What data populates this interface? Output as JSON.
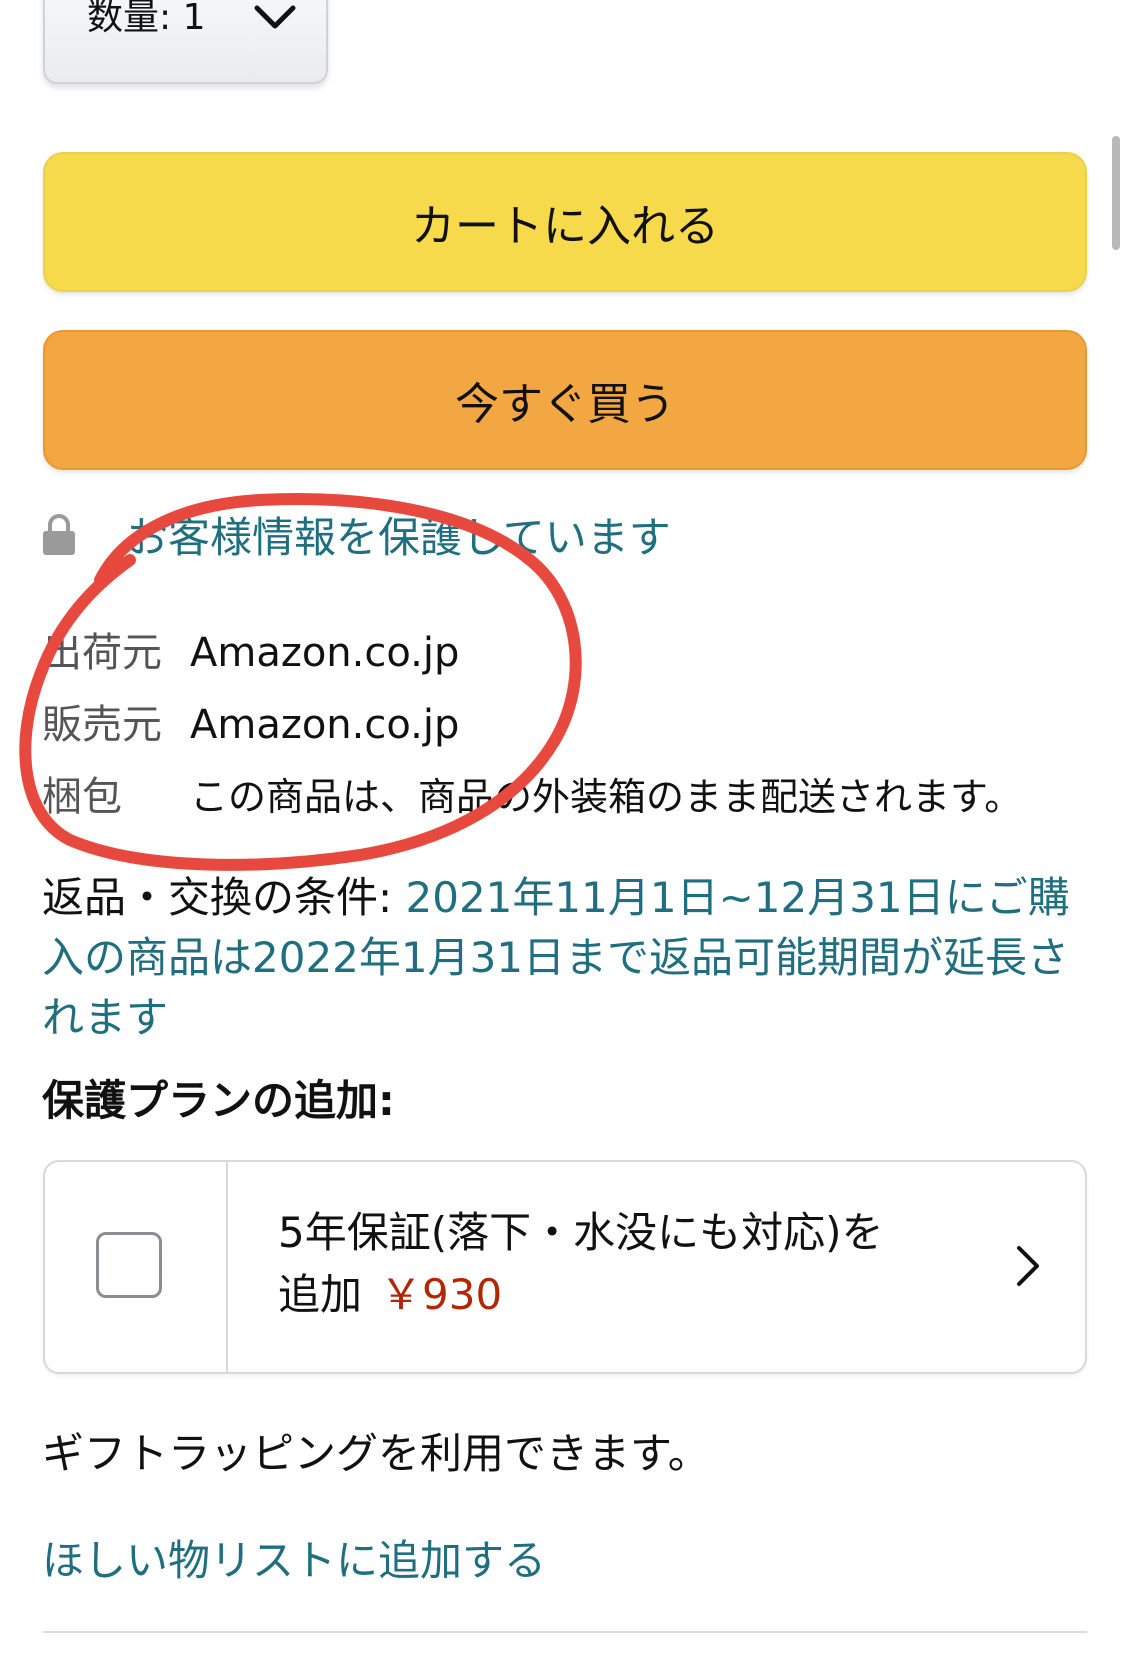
{
  "quantity": {
    "label": "数量: 1",
    "icon": "chevron-down-icon"
  },
  "buttons": {
    "add_to_cart": "カートに入れる",
    "buy_now": "今すぐ買う",
    "add_to_cart_color": "#f7d94c",
    "buy_now_color": "#f2a742"
  },
  "security": {
    "icon": "lock-icon",
    "text": "お客様情報を保護しています"
  },
  "seller_info": [
    {
      "label": "出荷元",
      "value": "Amazon.co.jp"
    },
    {
      "label": "販売元",
      "value": "Amazon.co.jp"
    },
    {
      "label": "梱包",
      "value": "この商品は、商品の外装箱のまま配送されます。"
    }
  ],
  "returns": {
    "label": "返品・交換の条件: ",
    "link": "2021年11月1日~12月31日にご購入の商品は2022年1月31日まで返品可能期間が延長されます"
  },
  "protection_plan": {
    "heading": "保護プランの追加:",
    "option_text": "5年保証(落下・水没にも対応)を追加",
    "price": "￥930",
    "checked": false,
    "price_color": "#b12704"
  },
  "gift": {
    "text": "ギフトラッピングを利用できます。"
  },
  "wishlist": {
    "link": "ほしい物リストに追加する"
  },
  "colors": {
    "link": "#1f6f80",
    "annotation": "#e8493f"
  }
}
